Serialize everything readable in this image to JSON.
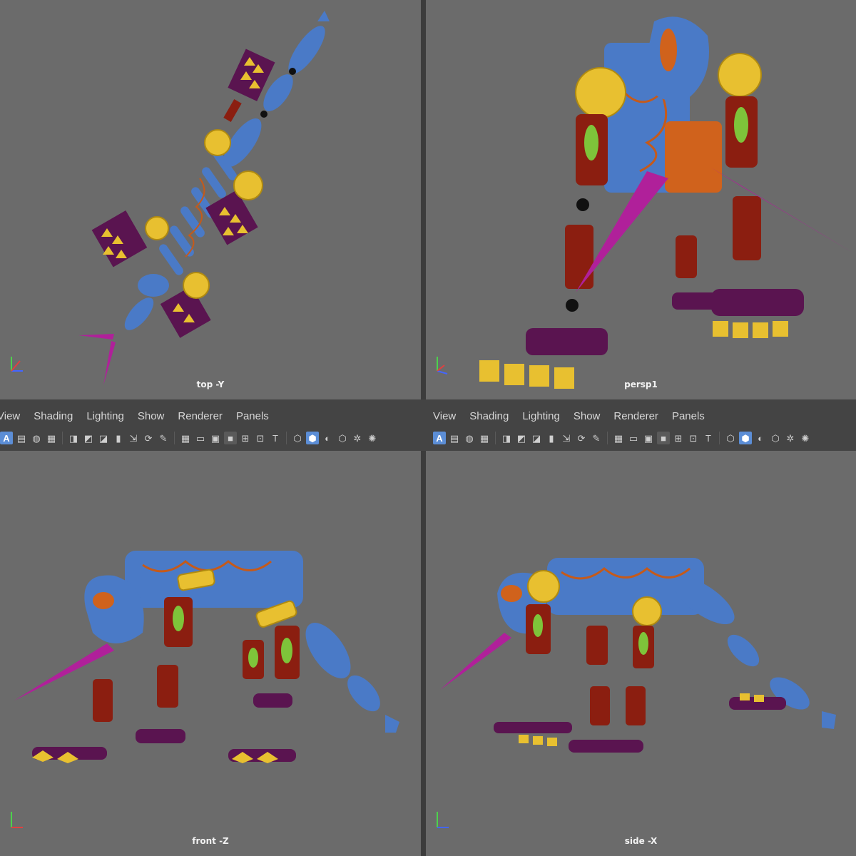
{
  "viewports": {
    "top": {
      "label": "top -Y"
    },
    "persp": {
      "label": "persp1"
    },
    "front": {
      "label": "front -Z"
    },
    "side": {
      "label": "side -X"
    }
  },
  "menus": {
    "left": [
      "View",
      "Shading",
      "Lighting",
      "Show",
      "Renderer",
      "Panels"
    ],
    "right": [
      "View",
      "Shading",
      "Lighting",
      "Show",
      "Renderer",
      "Panels"
    ]
  },
  "toolbar_icons": {
    "select_camera": "A",
    "items": [
      "camera-attributes-icon",
      "bookmark-icon",
      "image-plane-icon",
      "camera-icon",
      "film-gate-icon",
      "resolution-gate-icon",
      "grid-icon",
      "field-chart-icon",
      "safe-action-icon",
      "safe-title-icon",
      "wireframe-icon",
      "smooth-shade-icon",
      "shaded-wireframe-icon",
      "textured-icon",
      "lights-icon",
      "shadows-icon"
    ]
  },
  "colors": {
    "viewport_bg": "#6b6b6b",
    "body_blue": "#4a7ac7",
    "leg_red": "#8b1e10",
    "gear_yellow": "#e8c030",
    "foot_purple": "#5a1450",
    "spike_magenta": "#b0209a",
    "accent_green": "#7ec43a",
    "accent_orange": "#d0621c",
    "active_blue": "#5c8ed6"
  }
}
